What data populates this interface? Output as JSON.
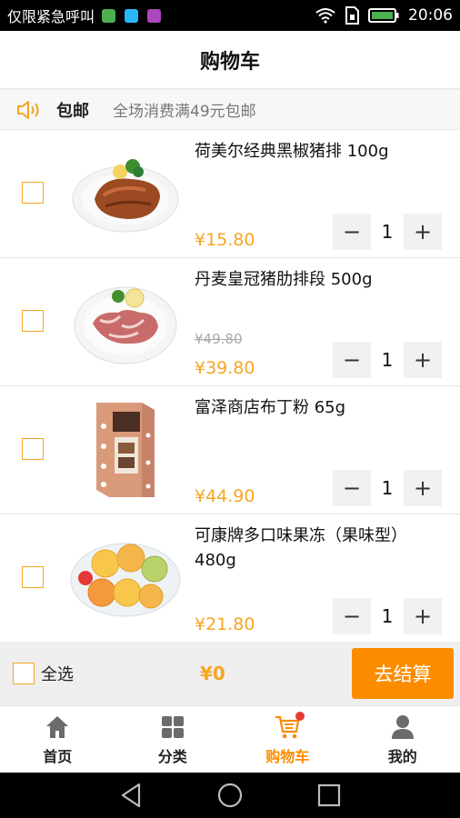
{
  "status_bar": {
    "carrier": "仅限紧急呼叫",
    "time": "20:06",
    "app_icon_colors": [
      "#4CAF50",
      "#29B6F6",
      "#AB47BC"
    ]
  },
  "header": {
    "title": "购物车"
  },
  "notice": {
    "icon": "speaker-icon",
    "tag": "包邮",
    "text": "全场消费满49元包邮"
  },
  "cart": {
    "items": [
      {
        "name": "荷美尔经典黑椒猪排 100g",
        "price": "¥15.80",
        "old_price": "",
        "quantity": "1",
        "image": "pepper-pork-chop"
      },
      {
        "name": "丹麦皇冠猪肋排段 500g",
        "price": "¥39.80",
        "old_price": "¥49.80",
        "quantity": "1",
        "image": "pork-ribs"
      },
      {
        "name": "富泽商店布丁粉 65g",
        "price": "¥44.90",
        "old_price": "",
        "quantity": "1",
        "image": "pudding-powder-box"
      },
      {
        "name": "可康牌多口味果冻（果味型）480g",
        "price": "¥21.80",
        "old_price": "",
        "quantity": "1",
        "image": "fruit-jelly-cups"
      }
    ],
    "decrement_symbol": "−",
    "increment_symbol": "+"
  },
  "checkout": {
    "select_all_label": "全选",
    "total": "¥0",
    "button_label": "去结算"
  },
  "tabbar": {
    "tabs": [
      {
        "label": "首页",
        "icon": "home-icon",
        "active": false
      },
      {
        "label": "分类",
        "icon": "category-icon",
        "active": false
      },
      {
        "label": "购物车",
        "icon": "cart-icon",
        "active": true
      },
      {
        "label": "我的",
        "icon": "profile-icon",
        "active": false
      }
    ]
  },
  "colors": {
    "accent": "#f5a623",
    "button": "#fb8c00",
    "badge": "#e53935"
  }
}
